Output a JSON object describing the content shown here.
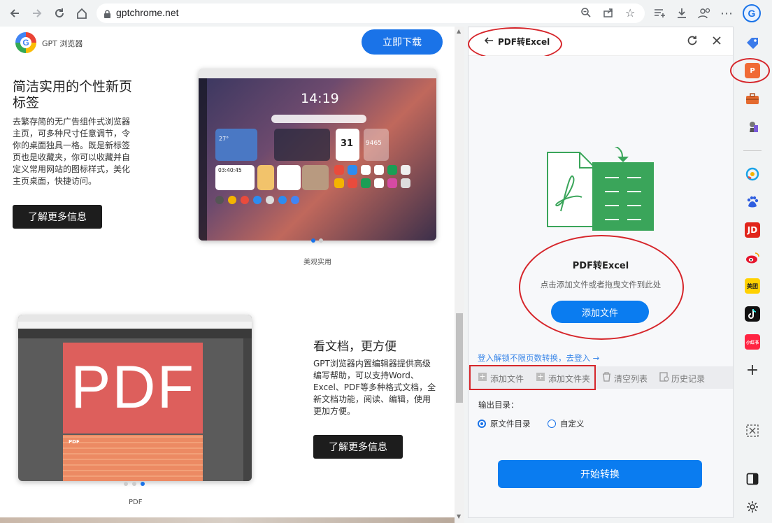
{
  "browser": {
    "url": "gptchrome.net"
  },
  "site": {
    "logo_name": "GPT 浏览器",
    "download_button": "立即下载",
    "section1": {
      "title_line1": "简洁实用的个性新页",
      "title_line2": "标签",
      "desc_lines": [
        "去繁存简的无广告组件式浏览器",
        "主页，可多种尺寸任意调节，令",
        "你的桌面独具一格。既是新标签",
        "页也是收藏夹，你可以收藏并自",
        "定义常用网站的图标样式，美化",
        "主页桌面，快捷访问。"
      ],
      "button": "了解更多信息",
      "screenshot_clock": "14:19",
      "screenshot_caption": "美观实用",
      "mock_temp": "27°",
      "mock_time": "03:40:45",
      "mock_date": "31",
      "mock_count": "9465"
    },
    "section2": {
      "title": "看文档，更方便",
      "desc_lines": [
        "GPT浏览器内置编辑器提供高级",
        "编写帮助，可以支持Word、",
        "Excel、PDF等多种格式文档，全",
        "新文档功能，阅读、编辑，使用",
        "更加方便。"
      ],
      "button": "了解更多信息",
      "pdf_big": "PDF",
      "pdf_small": "PDF",
      "screenshot_caption": "PDF"
    }
  },
  "panel": {
    "back_label": "PDF转Excel",
    "main_title": "PDF转Excel",
    "hint": "点击添加文件或者拖曳文件到此处",
    "add_file_button": "添加文件",
    "login_link": "登入解锁不限页数转换，去登入 →",
    "toolbar": {
      "add_file": "添加文件",
      "add_folder": "添加文件夹",
      "clear_list": "清空列表",
      "history": "历史记录"
    },
    "output_label": "输出目录：",
    "radio_original": "原文件目录",
    "radio_custom": "自定义",
    "start_button": "开始转换"
  },
  "sidebar": {
    "jd_label": "JD",
    "meituan_label": "美团",
    "pinduoduo_label": "小红书"
  },
  "colors": {
    "accent": "#1a73e8",
    "panel_blue": "#0a7cf0",
    "annotation_red": "#d6262b",
    "excel_green": "#3aa55a"
  }
}
